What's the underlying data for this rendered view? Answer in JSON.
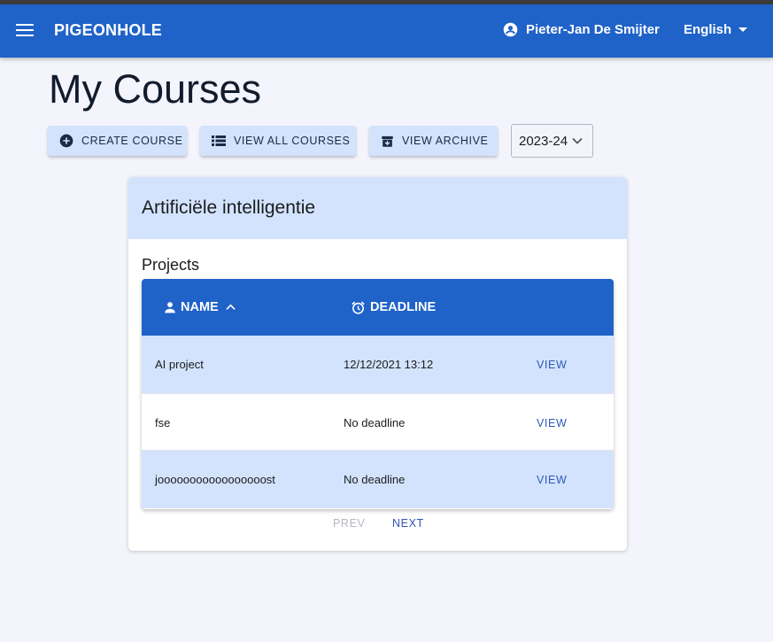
{
  "app": {
    "brand": "PIGEONHOLE",
    "user": "Pieter-Jan De Smijter",
    "language": "English"
  },
  "page": {
    "title": "My Courses"
  },
  "toolbar": {
    "create_label": "CREATE COURSE",
    "view_all_label": "VIEW ALL COURSES",
    "archive_label": "VIEW ARCHIVE",
    "year": "2023-24"
  },
  "course": {
    "name": "Artificiële intelligentie",
    "section": "Projects",
    "columns": {
      "name": "NAME",
      "deadline": "DEADLINE"
    },
    "projects": [
      {
        "name": "AI project",
        "deadline": "12/12/2021 13:12",
        "action": "VIEW"
      },
      {
        "name": "fse",
        "deadline": "No deadline",
        "action": "VIEW"
      },
      {
        "name": "jooooooooooooooooost",
        "deadline": "No deadline",
        "action": "VIEW"
      }
    ],
    "pager": {
      "prev": "PREV",
      "next": "NEXT"
    }
  },
  "colors": {
    "primary": "#1f62c8",
    "primary_light": "#d3e3fd",
    "background": "#f3f4fc",
    "link": "#2f58b6"
  },
  "icons": [
    "menu-icon",
    "account-circle-icon",
    "caret-down-icon",
    "add-circle-icon",
    "list-icon",
    "archive-icon",
    "chevron-down-icon",
    "person-icon",
    "sort-up-icon",
    "alarm-clock-icon"
  ]
}
